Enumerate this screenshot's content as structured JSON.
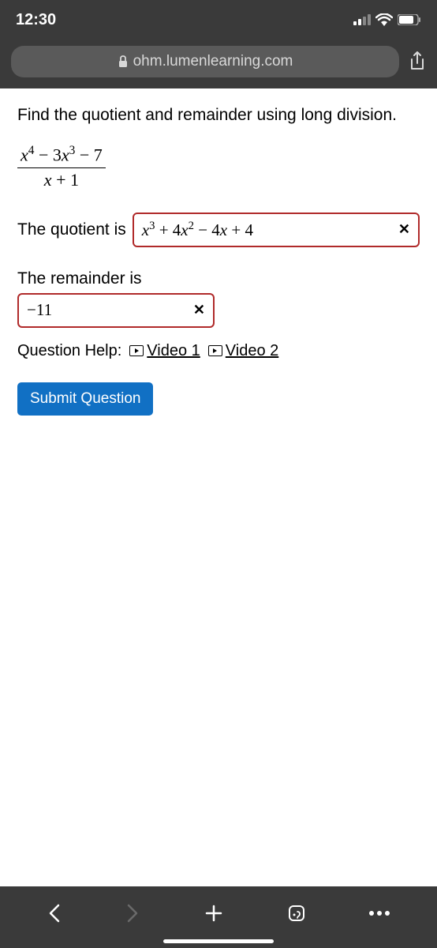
{
  "statusBar": {
    "time": "12:30"
  },
  "urlBar": {
    "domain": "ohm.lumenlearning.com"
  },
  "question": {
    "prompt": "Find the quotient and remainder using long division.",
    "fraction": {
      "numerator": "x⁴ − 3x³ − 7",
      "denominator": "x + 1"
    },
    "quotientLabel": "The quotient is",
    "quotientAnswer": "x³ + 4x² − 4x + 4",
    "quotientCorrect": false,
    "remainderLabel": "The remainder is",
    "remainderAnswer": "−11",
    "remainderCorrect": false
  },
  "help": {
    "label": "Question Help:",
    "video1": "Video 1",
    "video2": "Video 2"
  },
  "submit": {
    "label": "Submit Question"
  }
}
